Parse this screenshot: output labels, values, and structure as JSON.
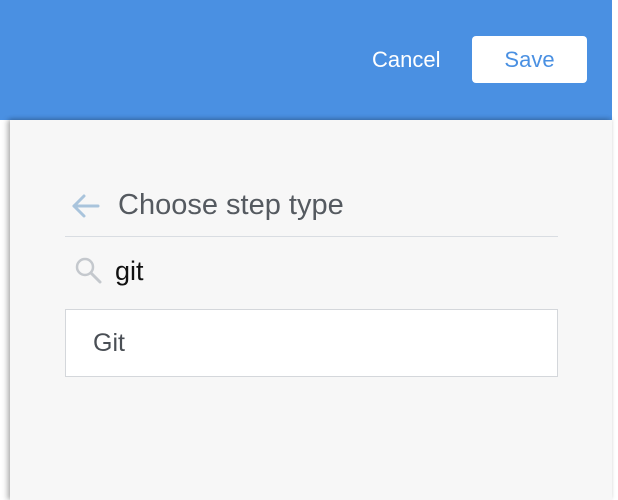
{
  "header": {
    "cancel_label": "Cancel",
    "save_label": "Save",
    "background_color": "#4a90e2"
  },
  "panel": {
    "title": "Choose step type",
    "back_icon": "arrow-left-icon",
    "search": {
      "icon": "search-icon",
      "value": "git",
      "placeholder": ""
    },
    "results": [
      {
        "label": "Git"
      }
    ]
  }
}
